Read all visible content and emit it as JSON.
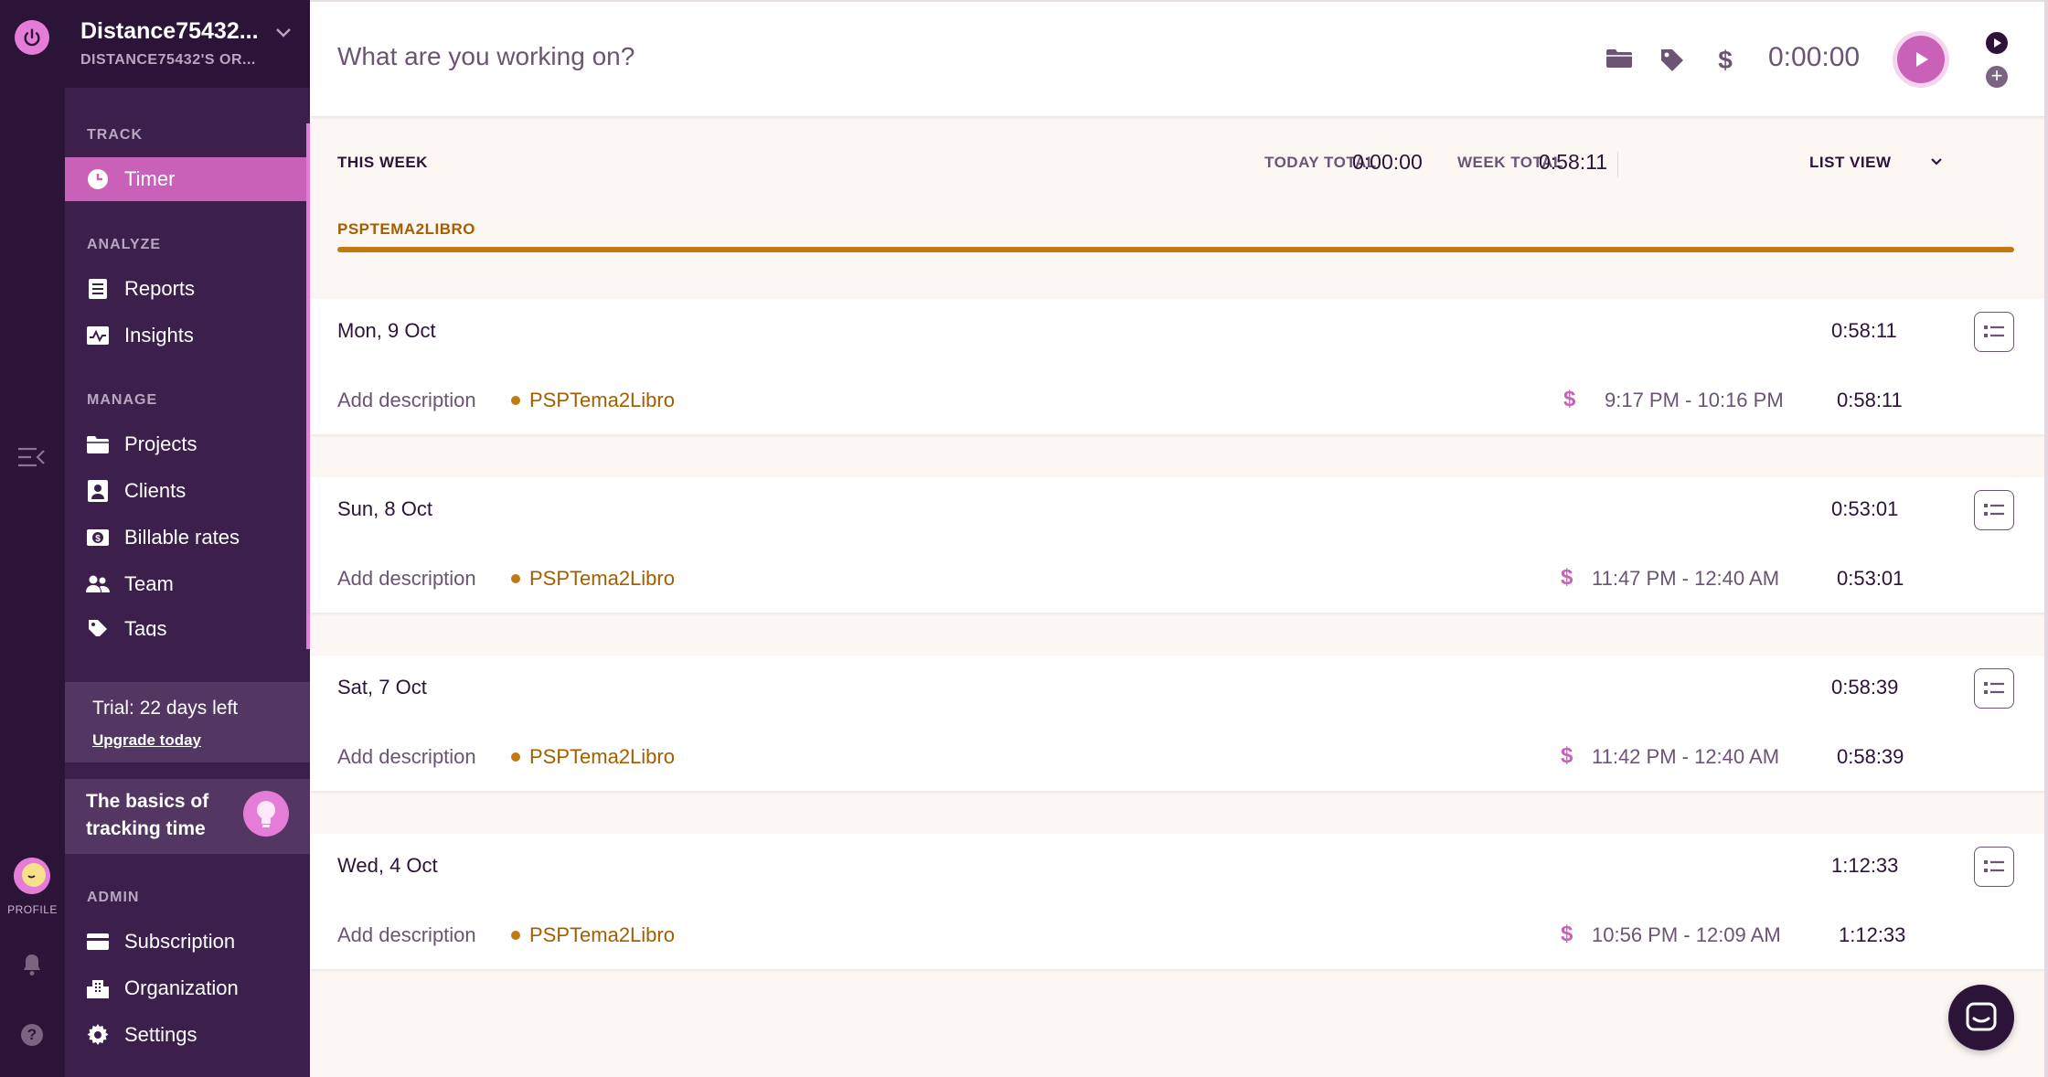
{
  "workspace": {
    "name": "Distance75432...",
    "org": "DISTANCE75432'S OR..."
  },
  "rail": {
    "profile_label": "PROFILE"
  },
  "sidebar": {
    "track_label": "TRACK",
    "timer": "Timer",
    "analyze_label": "ANALYZE",
    "reports": "Reports",
    "insights": "Insights",
    "manage_label": "MANAGE",
    "projects": "Projects",
    "clients": "Clients",
    "billable_rates": "Billable rates",
    "team": "Team",
    "tags": "Tags",
    "trial_text": "Trial: 22 days left",
    "upgrade": "Upgrade today",
    "basics": "The basics of tracking time",
    "admin_label": "ADMIN",
    "subscription": "Subscription",
    "organization": "Organization",
    "settings": "Settings"
  },
  "timer_bar": {
    "placeholder": "What are you working on?",
    "time": "0:00:00"
  },
  "summary": {
    "this_week": "THIS WEEK",
    "today_label": "TODAY TOTAL",
    "today_value": "0:00:00",
    "week_label": "WEEK TOTAL",
    "week_value": "0:58:11",
    "view": "LIST VIEW"
  },
  "project_bar": {
    "label": "PSPTEMA2LIBRO"
  },
  "days": [
    {
      "date": "Mon, 9 Oct",
      "total": "0:58:11",
      "description": "Add description",
      "project": "PSPTema2Libro",
      "range": "9:17 PM - 10:16 PM",
      "duration": "0:58:11"
    },
    {
      "date": "Sun, 8 Oct",
      "total": "0:53:01",
      "description": "Add description",
      "project": "PSPTema2Libro",
      "range": "11:47 PM - 12:40 AM",
      "duration": "0:53:01"
    },
    {
      "date": "Sat, 7 Oct",
      "total": "0:58:39",
      "description": "Add description",
      "project": "PSPTema2Libro",
      "range": "11:42 PM - 12:40 AM",
      "duration": "0:58:39"
    },
    {
      "date": "Wed, 4 Oct",
      "total": "1:12:33",
      "description": "Add description",
      "project": "PSPTema2Libro",
      "range": "10:56 PM - 12:09 AM",
      "duration": "1:12:33"
    }
  ],
  "colors": {
    "rail": "#2c1338",
    "sidebar": "#3d1f4b",
    "accent": "#c961b9",
    "project": "#c17a12"
  }
}
